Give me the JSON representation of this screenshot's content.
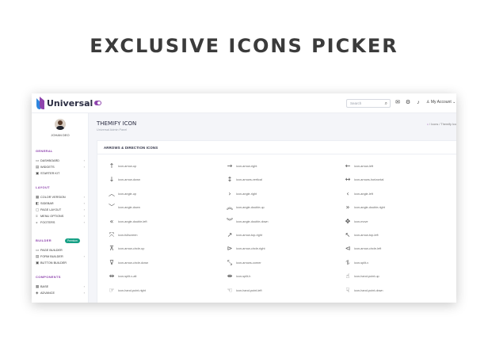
{
  "headline": "EXCLUSIVE ICONS PICKER",
  "topbar": {
    "brand": "Universal",
    "search_placeholder": "Search",
    "account_label": "My Account",
    "icons": [
      "search-icon",
      "mail-icon",
      "settings-icon",
      "bell-icon",
      "user-icon",
      "chevron-down-icon"
    ]
  },
  "sidebar": {
    "user_name": "JOHAN DEO",
    "sections": [
      {
        "title": "GENERAL",
        "items": [
          {
            "label": "DASHBOARD",
            "icon": "dashboard-icon",
            "chevron": true
          },
          {
            "label": "WIDGETS",
            "icon": "widgets-icon",
            "chevron": true
          },
          {
            "label": "STARTER KIT",
            "icon": "starter-kit-icon",
            "chevron": false
          }
        ]
      },
      {
        "title": "LAYOUT",
        "items": [
          {
            "label": "COLOR VERSION",
            "icon": "color-icon",
            "chevron": true
          },
          {
            "label": "SIDEBAR",
            "icon": "sidebar-icon",
            "chevron": true
          },
          {
            "label": "PAGE LAYOUT",
            "icon": "layout-icon",
            "chevron": true
          },
          {
            "label": "MENU OPTIONS",
            "icon": "menu-icon",
            "chevron": true
          },
          {
            "label": "FOOTERS",
            "icon": "footer-icon",
            "chevron": true
          }
        ]
      },
      {
        "title": "BUILDER",
        "badge": "Premium",
        "items": [
          {
            "label": "PAGE BUILDER",
            "icon": "page-builder-icon",
            "chevron": false
          },
          {
            "label": "FORM BUILDER",
            "icon": "form-builder-icon",
            "chevron": true
          },
          {
            "label": "BUTTON BUILDER",
            "icon": "button-builder-icon",
            "chevron": false
          }
        ]
      },
      {
        "title": "COMPONENTS",
        "items": [
          {
            "label": "BASE",
            "icon": "base-icon",
            "chevron": true
          },
          {
            "label": "ADVANCE",
            "icon": "advance-icon",
            "chevron": true
          }
        ]
      }
    ]
  },
  "page": {
    "title": "THEMIFY ICON",
    "subtitle": "Universal Admin Panel",
    "breadcrumb": "Icons",
    "breadcrumb_current": "Themify Ico"
  },
  "card": {
    "title": "ARROWS & DIRECTION ICONS"
  },
  "icons": [
    {
      "name": "icon-arrow-up",
      "glyph": "↑"
    },
    {
      "name": "icon-arrow-right",
      "glyph": "→"
    },
    {
      "name": "icon-arrow-left",
      "glyph": "←"
    },
    {
      "name": "icon-arrow-down",
      "glyph": "↓"
    },
    {
      "name": "icon-arrows-vertical",
      "glyph": "↕"
    },
    {
      "name": "icon-arrows-horizontal",
      "glyph": "↔"
    },
    {
      "name": "icon-angle-up",
      "glyph": "︿"
    },
    {
      "name": "icon-angle-right",
      "glyph": "›"
    },
    {
      "name": "icon-angle-left",
      "glyph": "‹"
    },
    {
      "name": "icon-angle-down",
      "glyph": "﹀"
    },
    {
      "name": "icon-angle-double-up",
      "glyph": "︽"
    },
    {
      "name": "icon-angle-double-right",
      "glyph": "»"
    },
    {
      "name": "icon-angle-double-left",
      "glyph": "«"
    },
    {
      "name": "icon-angle-double-down",
      "glyph": "︾"
    },
    {
      "name": "icon-move",
      "glyph": "✥"
    },
    {
      "name": "icon-fullscreen",
      "glyph": "⤧"
    },
    {
      "name": "icon-arrow-top-right",
      "glyph": "↗"
    },
    {
      "name": "icon-arrow-top-left",
      "glyph": "↖"
    },
    {
      "name": "icon-arrow-circle-up",
      "glyph": "⊼"
    },
    {
      "name": "icon-arrow-circle-right",
      "glyph": "⊳"
    },
    {
      "name": "icon-arrow-circle-left",
      "glyph": "⊲"
    },
    {
      "name": "icon-arrow-circle-down",
      "glyph": "⊽"
    },
    {
      "name": "icon-arrows-corner",
      "glyph": "⤡"
    },
    {
      "name": "icon-split-v",
      "glyph": "⥮"
    },
    {
      "name": "icon-split-v-alt",
      "glyph": "⇹"
    },
    {
      "name": "icon-split-h",
      "glyph": "⇼"
    },
    {
      "name": "icon-hand-point-up",
      "glyph": "☝"
    },
    {
      "name": "icon-hand-point-right",
      "glyph": "☞"
    },
    {
      "name": "icon-hand-point-left",
      "glyph": "☜"
    },
    {
      "name": "icon-hand-point-down",
      "glyph": "☟"
    }
  ],
  "colors": {
    "accent": "#8e44ad",
    "badge": "#16a085"
  }
}
